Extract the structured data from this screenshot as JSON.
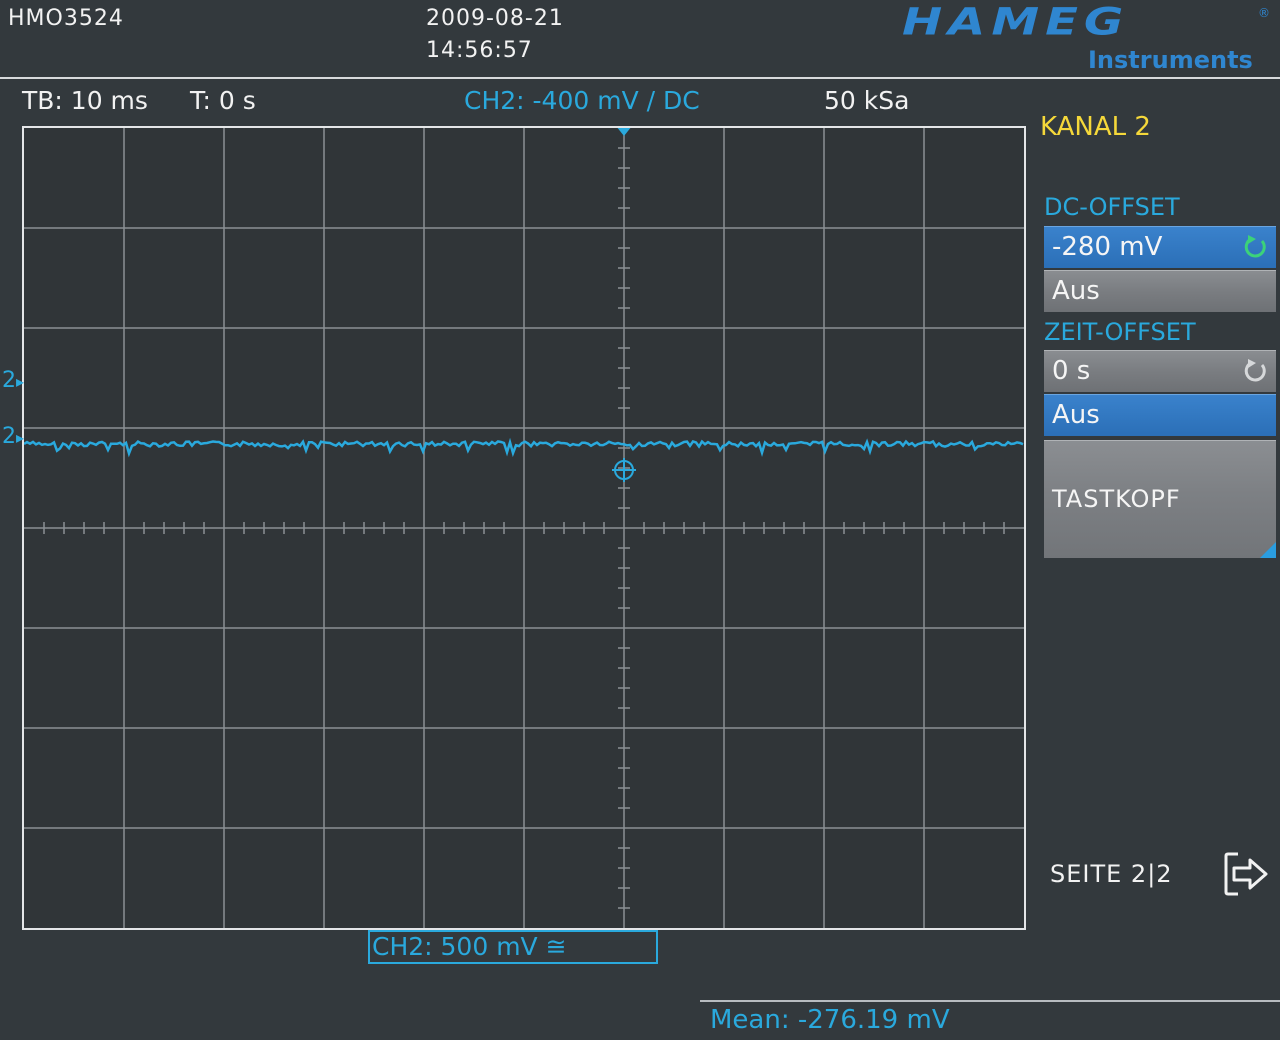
{
  "header": {
    "model": "HMO3524",
    "date": "2009-08-21",
    "time": "14:56:57",
    "logo_text": "HAMEG",
    "logo_sub": "Instruments"
  },
  "status_bar": {
    "timebase": "TB: 10 ms",
    "trigger_time": "T: 0 s",
    "channel_info": "CH2: -400 mV / DC",
    "sample_rate": "50 kSa"
  },
  "side_menu": {
    "title": "KANAL 2",
    "dc_offset_label": "DC-OFFSET",
    "dc_offset_value": "-280 mV",
    "dc_offset_off": "Aus",
    "time_offset_label": "ZEIT-OFFSET",
    "time_offset_value": "0 s",
    "time_offset_off": "Aus",
    "probe_button": "TASTKOPF",
    "page": "SEITE 2|2"
  },
  "channel_markers": {
    "marker_upper": "2",
    "marker_lower": "2"
  },
  "scale_box": "CH2: 500 mV ≅",
  "measurement": "Mean: -276.19 mV",
  "colors": {
    "trace": "#2aa9dd",
    "title": "#f5d83a",
    "selected_button": "#3a82cc"
  }
}
